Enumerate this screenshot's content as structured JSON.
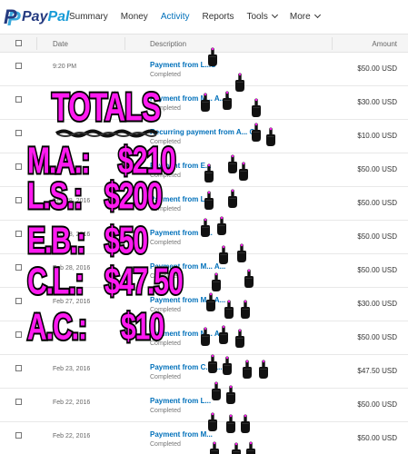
{
  "brand": {
    "pay": "Pay",
    "pal": "Pal"
  },
  "nav": [
    {
      "label": "Summary",
      "active": false,
      "dropdown": false
    },
    {
      "label": "Money",
      "active": false,
      "dropdown": false
    },
    {
      "label": "Activity",
      "active": true,
      "dropdown": false
    },
    {
      "label": "Reports",
      "active": false,
      "dropdown": false
    },
    {
      "label": "Tools",
      "active": false,
      "dropdown": true
    },
    {
      "label": "More",
      "active": false,
      "dropdown": true
    }
  ],
  "table": {
    "headers": {
      "date": "Date",
      "description": "Description",
      "amount": "Amount"
    },
    "rows": [
      {
        "date": "9:20 PM",
        "title": "Payment from L...S",
        "status": "Completed",
        "amount": "$50.00 USD"
      },
      {
        "date": "",
        "title": "Payment from M... A...s",
        "status": "Completed",
        "amount": "$30.00 USD"
      },
      {
        "date": "",
        "title": "Recurring payment from A... C...",
        "status": "Completed",
        "amount": "$10.00 USD"
      },
      {
        "date": "",
        "title": "Payment from E...",
        "status": "Completed",
        "amount": "$50.00 USD"
      },
      {
        "date": "Feb 28, 2016",
        "title": "Payment from L...",
        "status": "Completed",
        "amount": "$50.00 USD"
      },
      {
        "date": "Feb 28, 2016",
        "title": "Payment from M...",
        "status": "Completed",
        "amount": "$50.00 USD"
      },
      {
        "date": "Feb 28, 2016",
        "title": "Payment from M... A...",
        "status": "Completed",
        "amount": "$50.00 USD"
      },
      {
        "date": "Feb 27, 2016",
        "title": "Payment from M... A...",
        "status": "Completed",
        "amount": "$30.00 USD"
      },
      {
        "date": "",
        "title": "Payment from M... A...",
        "status": "Completed",
        "amount": "$50.00 USD"
      },
      {
        "date": "Feb 23, 2016",
        "title": "Payment from C... L...",
        "status": "Completed",
        "amount": "$47.50 USD"
      },
      {
        "date": "Feb 22, 2016",
        "title": "Payment from L...",
        "status": "Completed",
        "amount": "$50.00 USD"
      },
      {
        "date": "Feb 22, 2016",
        "title": "Payment from M...",
        "status": "Completed",
        "amount": "$50.00 USD"
      }
    ]
  },
  "overlay": {
    "title": "TOTALS",
    "totals": [
      {
        "name": "M.A.:",
        "amount": "$210"
      },
      {
        "name": "L.S.:",
        "amount": "$200"
      },
      {
        "name": "E.B.:",
        "amount": "$50"
      },
      {
        "name": "C.L.:",
        "amount": "$47.50"
      },
      {
        "name": "A.C.:",
        "amount": "$10"
      }
    ],
    "accent_color": "#ff1af0",
    "sticker_icon": "middle-finger-icon"
  },
  "colors": {
    "link": "#0070ba",
    "brand_dark": "#253b80",
    "brand_light": "#179bd7"
  }
}
